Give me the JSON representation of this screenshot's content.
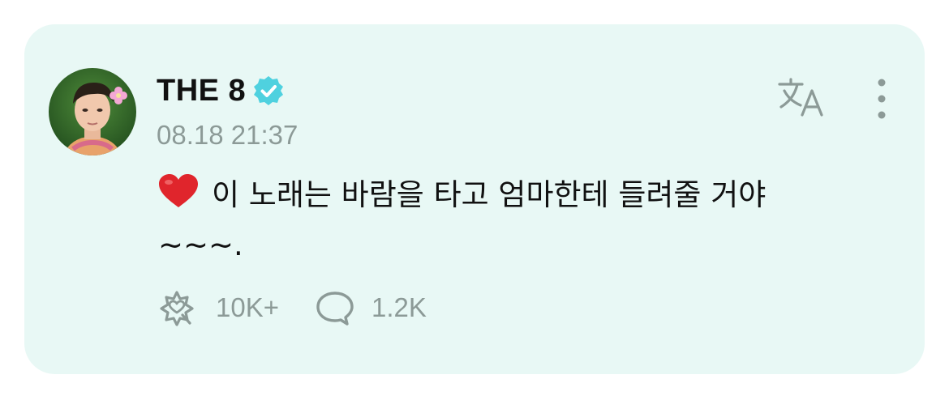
{
  "post": {
    "author": "THE 8",
    "timestamp": "08.18 21:37",
    "text_line1": "이 노래는 바람을 타고 엄마한테 들려줄 거야",
    "text_line2": "~~~.",
    "likes_count": "10K+",
    "comments_count": "1.2K"
  },
  "icons": {
    "verified": "verified-badge-icon",
    "translate": "translate-icon",
    "more": "more-vertical-icon",
    "heart": "heart-emoji",
    "like": "flower-heart-icon",
    "comment": "comment-bubble-icon"
  },
  "colors": {
    "card_background": "#e8f8f5",
    "verified": "#4fd1df",
    "muted": "#8c9a97",
    "text": "#111111",
    "heart": "#e0252c"
  }
}
